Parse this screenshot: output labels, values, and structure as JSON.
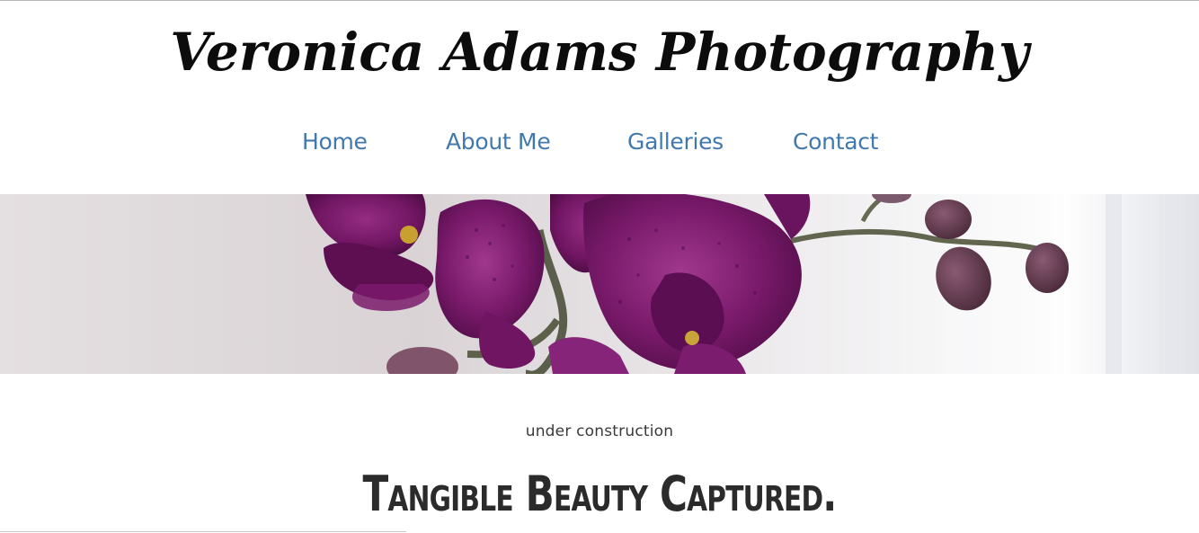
{
  "site": {
    "title": "Veronica Adams Photography"
  },
  "nav": {
    "items": [
      {
        "label": "Home"
      },
      {
        "label": "About Me"
      },
      {
        "label": "Galleries"
      },
      {
        "label": "Contact"
      }
    ]
  },
  "hero": {
    "image_alt": "purple orchid banner",
    "colors": {
      "petal": "#7a1a6b",
      "petal_dark": "#4e0c45",
      "background": "#e9e4e6",
      "stem": "#5b5e4a"
    }
  },
  "main": {
    "subtitle": "under construction",
    "tagline": "Tangible Beauty Captured."
  },
  "colors": {
    "nav_link": "#4178ad",
    "title_text": "#0c0c0c",
    "body_text": "#3a3a3a"
  }
}
